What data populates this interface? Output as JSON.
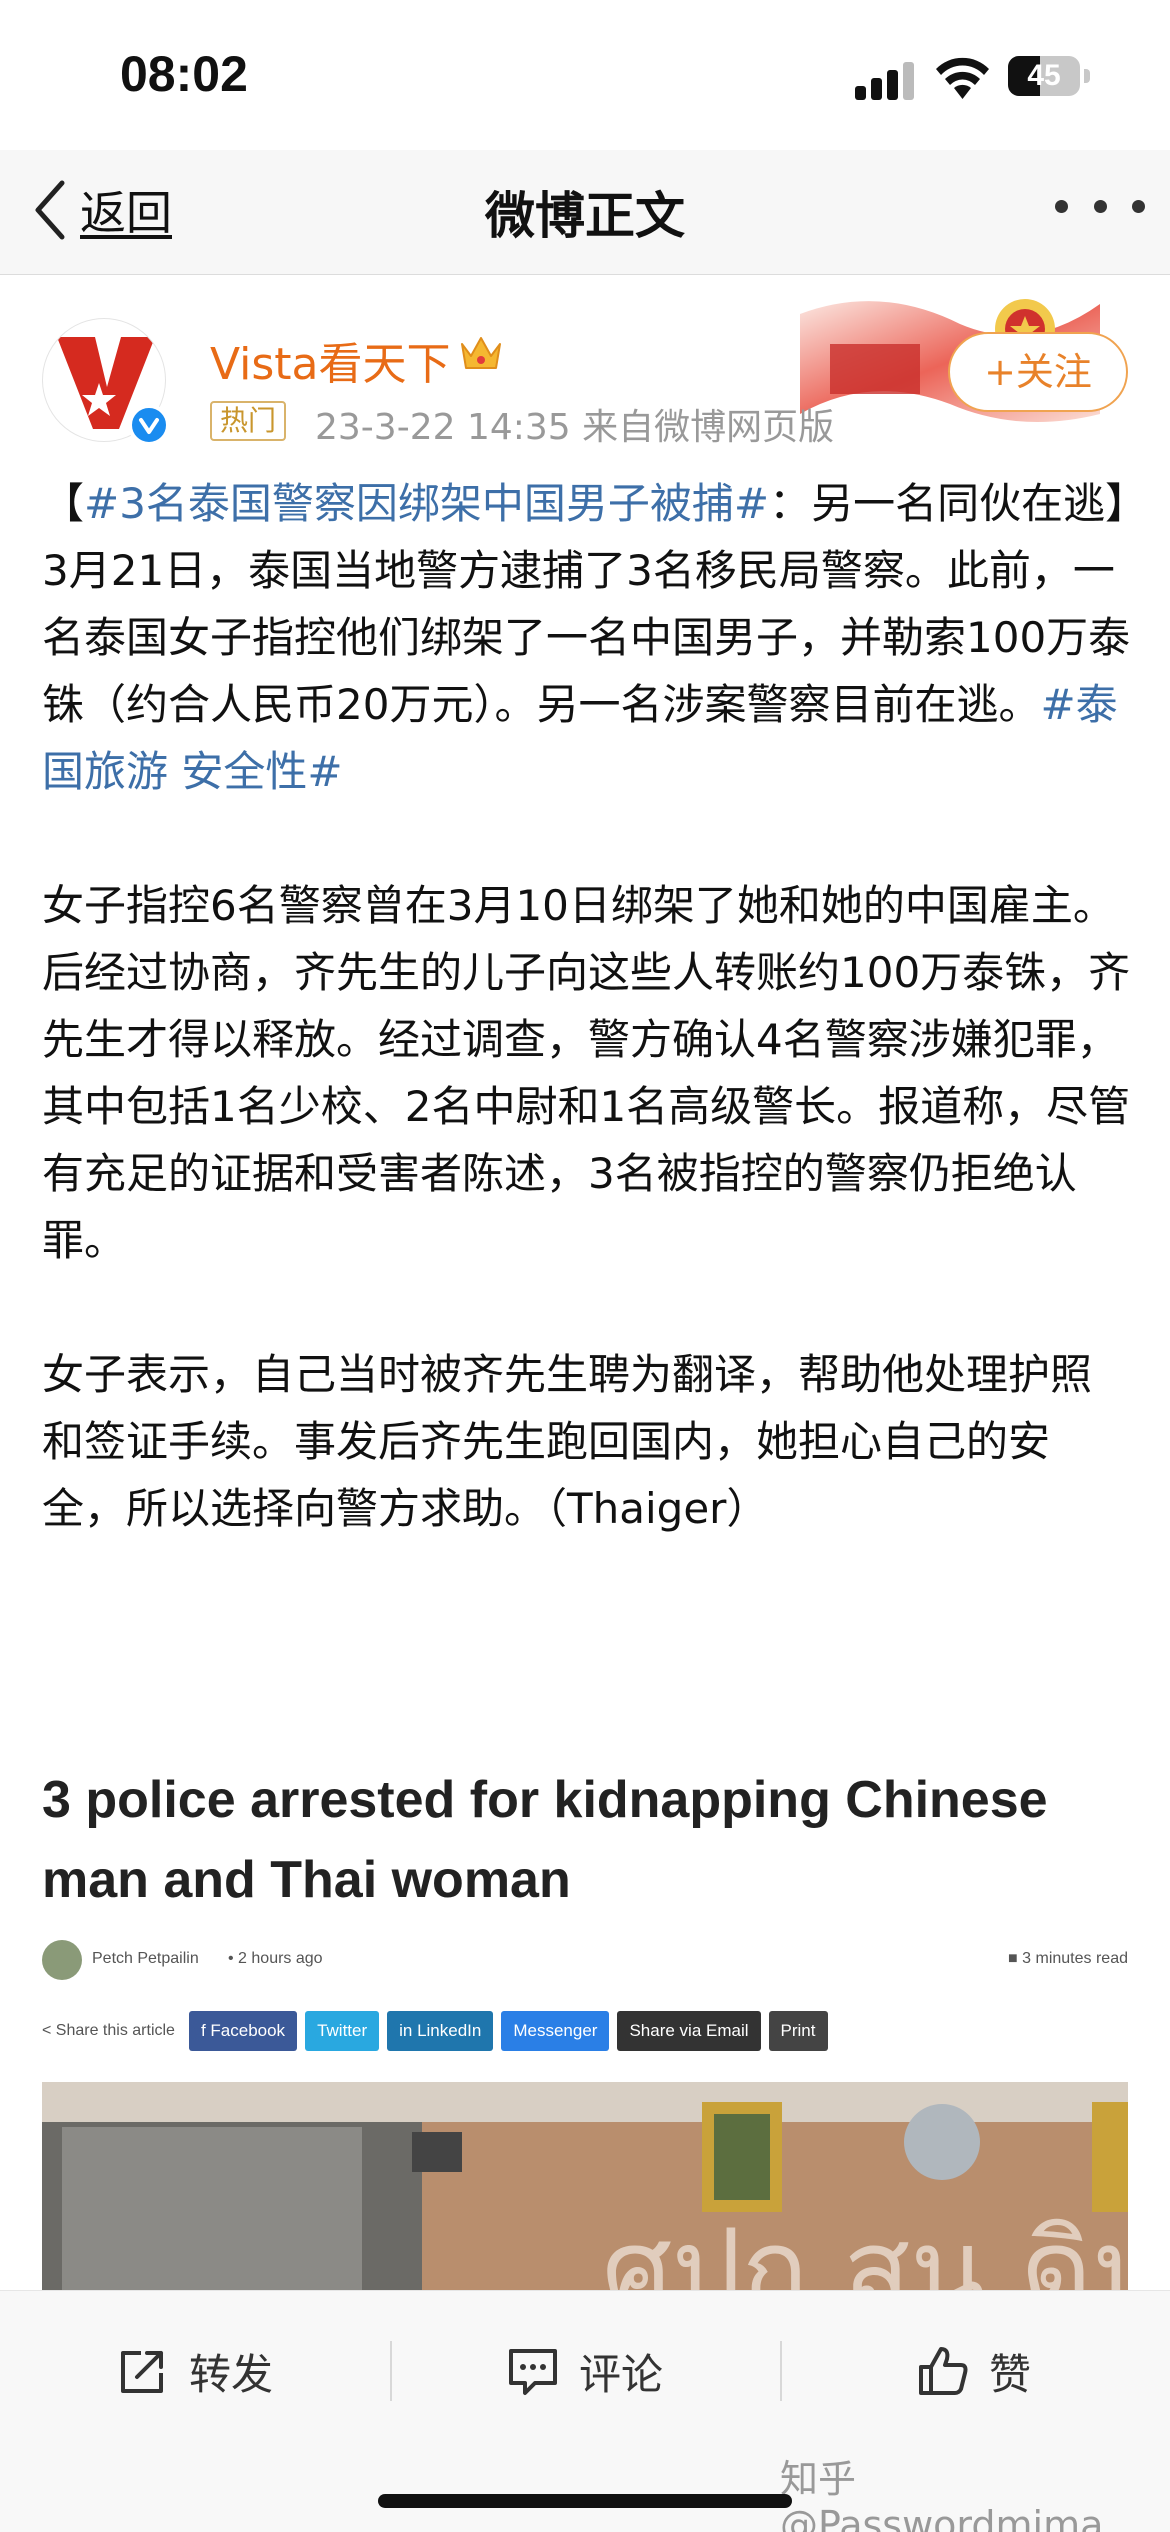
{
  "status_bar": {
    "time": "08:02",
    "battery": "45",
    "battery_percent": 45
  },
  "nav": {
    "back_label": "返回",
    "title": "微博正文"
  },
  "post": {
    "user_name": "Vista看天下",
    "hot_badge": "热门",
    "meta": "23-3-22 14:35  来自微博网页版",
    "follow_label": "+关注",
    "paragraphs": [
      {
        "segments": [
          {
            "text": "【",
            "topic": false
          },
          {
            "text": "#3名泰国警察因绑架中国男子被捕#",
            "topic": true
          },
          {
            "text": "：另一名同伙在逃】3月21日，泰国当地警方逮捕了3名移民局警察。此前，一名泰国女子指控他们绑架了一名中国男子，并勒索100万泰铢（约合人民币20万元）。另一名涉案警察目前在逃。",
            "topic": false
          },
          {
            "text": "#泰国旅游 安全性#",
            "topic": true
          }
        ]
      },
      {
        "segments": [
          {
            "text": "女子指控6名警察曾在3月10日绑架了她和她的中国雇主。后经过协商，齐先生的儿子向这些人转账约100万泰铢，齐先生才得以释放。经过调查，警方确认4名警察涉嫌犯罪，其中包括1名少校、2名中尉和1名高级警长。报道称，尽管有充足的证据和受害者陈述，3名被指控的警察仍拒绝认罪。",
            "topic": false
          }
        ]
      },
      {
        "segments": [
          {
            "text": "女子表示，自己当时被齐先生聘为翻译，帮助他处理护照和签证手续。事发后齐先生跑回国内，她担心自己的安全，所以选择向警方求助。（Thaiger）",
            "topic": false
          }
        ]
      }
    ]
  },
  "article": {
    "title": "3 police arrested for kidnapping Chinese man and Thai woman",
    "author": "Petch Petpailin",
    "time": "• 2 hours ago",
    "read_time": "■ 3 minutes read",
    "share_label": "< Share this article",
    "share_buttons": [
      {
        "label": "f  Facebook",
        "color": "#3b5998"
      },
      {
        "label": "Twitter",
        "color": "#29a8e0"
      },
      {
        "label": "in  LinkedIn",
        "color": "#1f76ad"
      },
      {
        "label": "Messenger",
        "color": "#2a7fe6"
      },
      {
        "label": "Share via Email",
        "color": "#333333"
      },
      {
        "label": "Print",
        "color": "#444444"
      }
    ],
    "photo_sign_text": "ศปก.สน.ดิน"
  },
  "bottom_bar": {
    "repost_label": "转发",
    "comment_label": "评论",
    "like_label": "赞"
  },
  "watermark": "知乎 @Passwordmima"
}
